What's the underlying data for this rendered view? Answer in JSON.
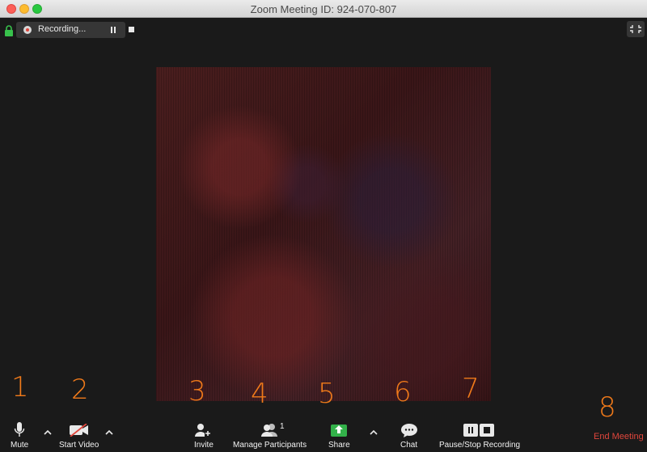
{
  "window": {
    "title": "Zoom Meeting ID: 924-070-807"
  },
  "recording": {
    "status_label": "Recording..."
  },
  "toolbar": {
    "mute_label": "Mute",
    "start_video_label": "Start Video",
    "invite_label": "Invite",
    "manage_participants_label": "Manage Participants",
    "participant_count": "1",
    "share_label": "Share",
    "chat_label": "Chat",
    "pause_stop_recording_label": "Pause/Stop Recording",
    "end_meeting_label": "End Meeting"
  },
  "annotations": [
    "1",
    "2",
    "3",
    "4",
    "5",
    "6",
    "7",
    "8"
  ],
  "colors": {
    "end_meeting": "#e0463c",
    "share_green": "#33b24a",
    "annotation_orange": "#f07a1a",
    "recording_red": "#e0463c"
  },
  "icons": {
    "lock": "lock-icon",
    "fullscreen": "exit-fullscreen-icon",
    "mute": "microphone-icon",
    "video": "video-off-icon",
    "invite": "add-user-icon",
    "participants": "participants-icon",
    "share": "share-screen-icon",
    "chat": "chat-bubble-icon",
    "recording": "pause-stop-icon"
  }
}
